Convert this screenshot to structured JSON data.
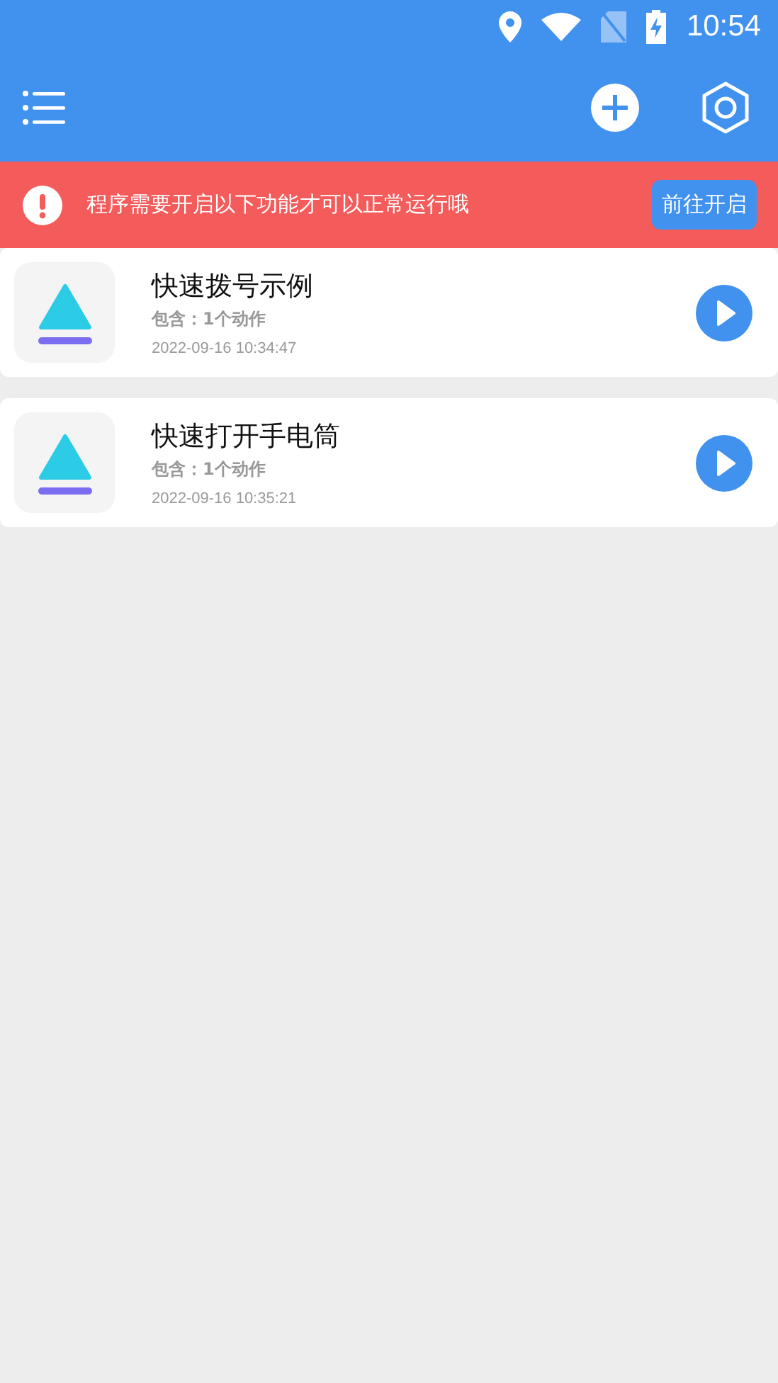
{
  "status_bar": {
    "time": "10:54"
  },
  "notice": {
    "text": "程序需要开启以下功能才可以正常运行哦",
    "button": "前往开启"
  },
  "tasks": [
    {
      "title": "快速拨号示例",
      "summary": "包含：1个动作",
      "created": "2022-09-16 10:34:47"
    },
    {
      "title": "快速打开手电筒",
      "summary": "包含：1个动作",
      "created": "2022-09-16 10:35:21"
    }
  ]
}
